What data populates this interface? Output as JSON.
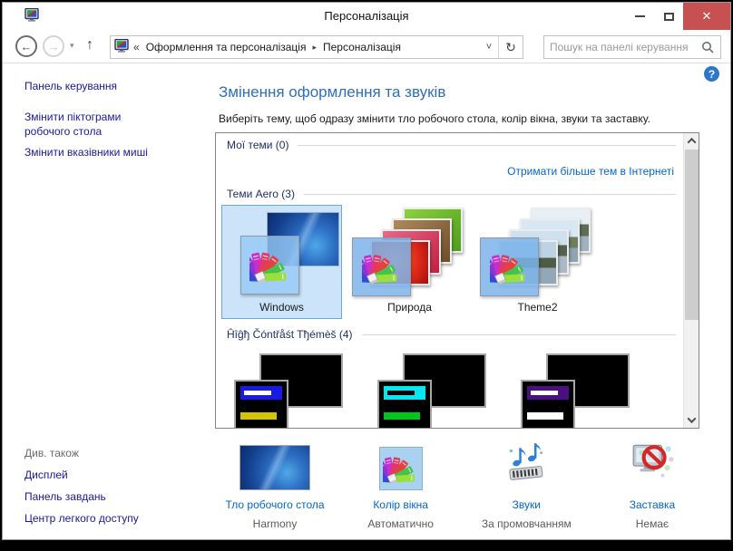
{
  "window": {
    "title": "Персоналізація",
    "close_glyph": "✕"
  },
  "icons": {
    "app_icon": "display-properties-monitor",
    "back_glyph": "←",
    "forward_glyph": "→",
    "up_glyph": "↑",
    "toolbar_dropdown_glyph": "▾",
    "address_dropdown_glyph": "˅",
    "refresh_glyph": "↻",
    "breadcrumb_prefix_glyph": "«",
    "breadcrumb_separator_glyph": "▸",
    "help_glyph": "?"
  },
  "toolbar": {
    "breadcrumb": [
      "Оформлення та персоналізація",
      "Персоналізація"
    ],
    "search_placeholder": "Пошук на панелі керування"
  },
  "sidebar": {
    "home": "Панель керування",
    "tasks": [
      "Змінити піктограми робочого стола",
      "Змінити вказівники миші"
    ],
    "see_also_header": "Див. також",
    "see_also": [
      "Дисплей",
      "Панель завдань",
      "Центр легкого доступу"
    ]
  },
  "main": {
    "heading": "Змінення оформлення та звуків",
    "description": "Виберіть тему, щоб одразу змінити тло робочого стола, колір вікна, звуки та заставку.",
    "my_themes_header": "Мої теми (0)",
    "get_more_link": "Отримати більше тем в Інтернеті",
    "aero_header": "Теми Aero (3)",
    "high_contrast_header": "Ĥîĝђ Čóntřåśt Tђémèš (4)",
    "aero_themes": [
      {
        "name": "Windows",
        "selected": true
      },
      {
        "name": "Природа",
        "selected": false
      },
      {
        "name": "Theme2",
        "selected": false
      }
    ]
  },
  "footer": {
    "items": [
      {
        "label": "Тло робочого стола",
        "value": "Harmony"
      },
      {
        "label": "Колір вікна",
        "value": "Автоматично"
      },
      {
        "label": "Звуки",
        "value": "За промовчанням"
      },
      {
        "label": "Заставка",
        "value": "Немає"
      }
    ]
  },
  "colors": {
    "accent_link": "#0066cc",
    "sidebar_link": "#19199a",
    "heading": "#2e6fb7",
    "group_header": "#1f2f64",
    "close_button": "#c75050",
    "selected_tile_bg": "#cbe4f9",
    "selected_tile_border": "#6da8dc"
  }
}
